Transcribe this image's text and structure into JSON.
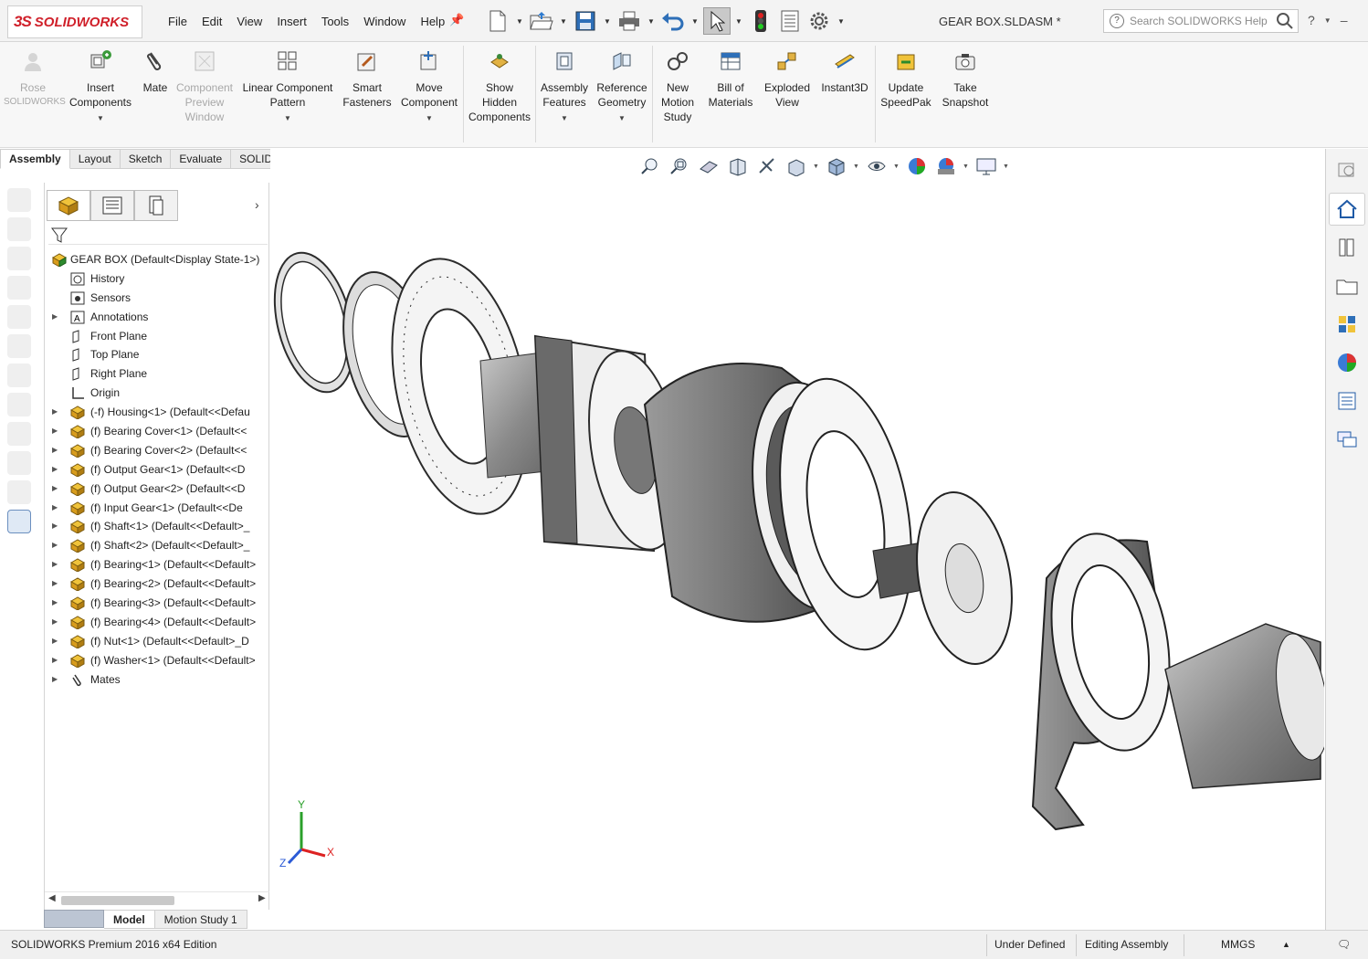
{
  "app": {
    "brand_ds": "3S",
    "brand_name": "SOLIDWORKS",
    "document_title": "GEAR BOX.SLDASM *",
    "help_search_placeholder": "Search SOLIDWORKS Help"
  },
  "menu": [
    "File",
    "Edit",
    "View",
    "Insert",
    "Tools",
    "Window",
    "Help"
  ],
  "ribbon": {
    "buttons": [
      {
        "label1": "Rose",
        "label2": "SOLIDWORKS",
        "label3": "",
        "disabled": true
      },
      {
        "label1": "Insert",
        "label2": "Components",
        "label3": "",
        "disabled": false
      },
      {
        "label1": "Mate",
        "label2": "",
        "label3": "",
        "disabled": false
      },
      {
        "label1": "Component",
        "label2": "Preview",
        "label3": "Window",
        "disabled": true
      },
      {
        "label1": "Linear Component",
        "label2": "Pattern",
        "label3": "",
        "disabled": false
      },
      {
        "label1": "Smart",
        "label2": "Fasteners",
        "label3": "",
        "disabled": false
      },
      {
        "label1": "Move",
        "label2": "Component",
        "label3": "",
        "disabled": false
      },
      {
        "label1": "Show",
        "label2": "Hidden",
        "label3": "Components",
        "disabled": false
      },
      {
        "label1": "Assembly",
        "label2": "Features",
        "label3": "",
        "disabled": false
      },
      {
        "label1": "Reference",
        "label2": "Geometry",
        "label3": "",
        "disabled": false
      },
      {
        "label1": "New",
        "label2": "Motion",
        "label3": "Study",
        "disabled": false
      },
      {
        "label1": "Bill of",
        "label2": "Materials",
        "label3": "",
        "disabled": false
      },
      {
        "label1": "Exploded",
        "label2": "View",
        "label3": "",
        "disabled": false
      },
      {
        "label1": "Instant3D",
        "label2": "",
        "label3": "",
        "disabled": false
      },
      {
        "label1": "Update",
        "label2": "SpeedPak",
        "label3": "",
        "disabled": false
      },
      {
        "label1": "Take",
        "label2": "Snapshot",
        "label3": "",
        "disabled": false
      }
    ]
  },
  "tabs": [
    "Assembly",
    "Layout",
    "Sketch",
    "Evaluate",
    "SOLIDWORKS Add-Ins"
  ],
  "tree": {
    "root": "GEAR BOX  (Default<Display State-1>)",
    "items": [
      {
        "label": "History",
        "icon": "history-icon",
        "expandable": false
      },
      {
        "label": "Sensors",
        "icon": "sensors-icon",
        "expandable": false
      },
      {
        "label": "Annotations",
        "icon": "annotations-icon",
        "expandable": true
      },
      {
        "label": "Front Plane",
        "icon": "plane-icon",
        "expandable": false
      },
      {
        "label": "Top Plane",
        "icon": "plane-icon",
        "expandable": false
      },
      {
        "label": "Right Plane",
        "icon": "plane-icon",
        "expandable": false
      },
      {
        "label": "Origin",
        "icon": "origin-icon",
        "expandable": false
      },
      {
        "label": "(-f) Housing<1> (Default<<Defau",
        "icon": "part-icon",
        "expandable": true
      },
      {
        "label": "(f) Bearing Cover<1> (Default<<",
        "icon": "part-icon",
        "expandable": true
      },
      {
        "label": "(f) Bearing Cover<2> (Default<<",
        "icon": "part-icon",
        "expandable": true
      },
      {
        "label": "(f) Output Gear<1> (Default<<D",
        "icon": "part-icon",
        "expandable": true
      },
      {
        "label": "(f) Output Gear<2> (Default<<D",
        "icon": "part-icon",
        "expandable": true
      },
      {
        "label": "(f) Input Gear<1> (Default<<De",
        "icon": "part-icon",
        "expandable": true
      },
      {
        "label": "(f) Shaft<1> (Default<<Default>_",
        "icon": "part-icon",
        "expandable": true
      },
      {
        "label": "(f) Shaft<2> (Default<<Default>_",
        "icon": "part-icon",
        "expandable": true
      },
      {
        "label": "(f) Bearing<1> (Default<<Default>",
        "icon": "part-icon",
        "expandable": true
      },
      {
        "label": "(f) Bearing<2> (Default<<Default>",
        "icon": "part-icon",
        "expandable": true
      },
      {
        "label": "(f) Bearing<3> (Default<<Default>",
        "icon": "part-icon",
        "expandable": true
      },
      {
        "label": "(f) Bearing<4> (Default<<Default>",
        "icon": "part-icon",
        "expandable": true
      },
      {
        "label": "(f) Nut<1> (Default<<Default>_D",
        "icon": "part-icon",
        "expandable": true
      },
      {
        "label": "(f) Washer<1> (Default<<Default>",
        "icon": "part-icon",
        "expandable": true
      },
      {
        "label": "Mates",
        "icon": "mates-icon",
        "expandable": true
      }
    ]
  },
  "bottom_tabs": [
    "Model",
    "Motion Study 1"
  ],
  "triad": {
    "x": "X",
    "y": "Y",
    "z": "Z"
  },
  "status": {
    "edition": "SOLIDWORKS Premium 2016 x64 Edition",
    "state": "Under Defined",
    "mode": "Editing Assembly",
    "units": "MMGS"
  },
  "colors": {
    "brand": "#d0202a",
    "part_icon": "#e0a21a",
    "accent": "#3a6fb5"
  }
}
